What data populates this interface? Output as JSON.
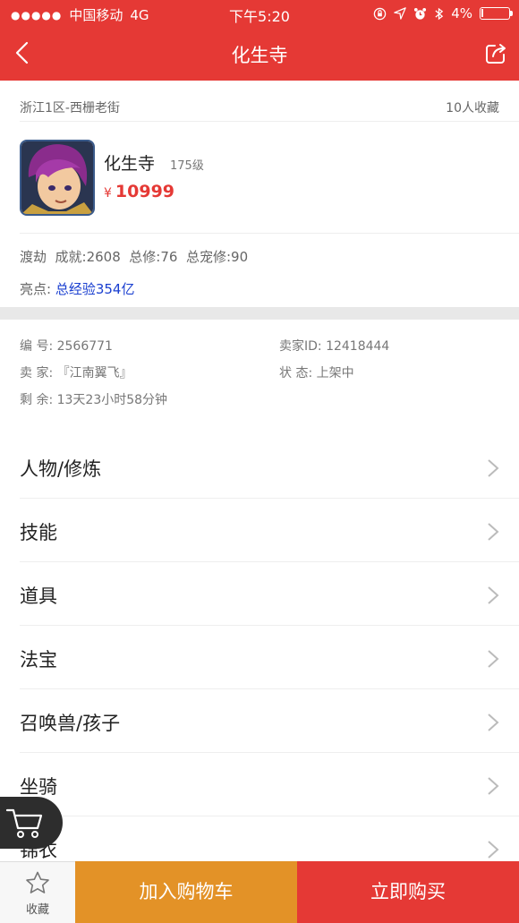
{
  "status_bar": {
    "carrier": "中国移动",
    "network": "4G",
    "time": "下午5:20",
    "battery": "4%"
  },
  "nav": {
    "title": "化生寺"
  },
  "listing": {
    "location": "浙江1区-西栅老街",
    "favorites_count": "10人收藏",
    "character_name": "化生寺",
    "level": "175级",
    "price_symbol": "¥",
    "price": "10999",
    "stats": "渡劫  成就:2608  总修:76  总宠修:90",
    "highlight_label": "亮点: ",
    "highlight_value": "总经验354亿"
  },
  "details": {
    "id_label": "编  号: 2566771",
    "seller_id": "卖家ID: 12418444",
    "seller": "卖  家: 『江南翼飞』",
    "status": "状  态: 上架中",
    "remaining": "剩  余: 13天23小时58分钟"
  },
  "menu": [
    {
      "label": "人物/修炼"
    },
    {
      "label": "技能"
    },
    {
      "label": "道具"
    },
    {
      "label": "法宝"
    },
    {
      "label": "召唤兽/孩子"
    },
    {
      "label": "坐骑"
    },
    {
      "label": "锦衣"
    }
  ],
  "bottom_bar": {
    "favorite": "收藏",
    "add_to_cart": "加入购物车",
    "buy_now": "立即购买"
  },
  "colors": {
    "brand_red": "#e53935",
    "cart_orange": "#e39227",
    "highlight_blue": "#1a3fd0"
  }
}
